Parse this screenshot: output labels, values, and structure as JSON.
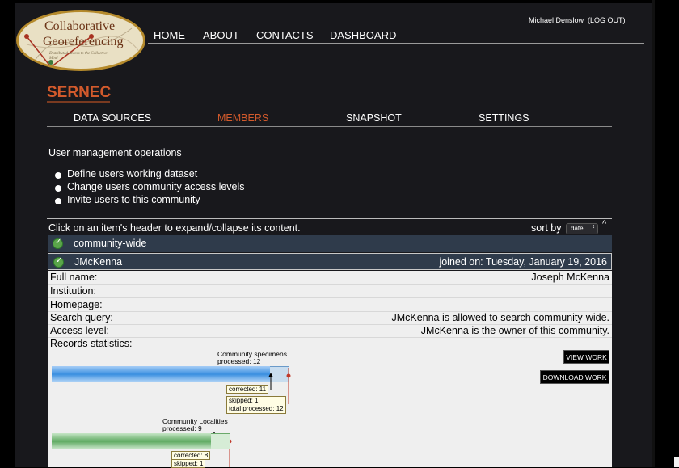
{
  "logo": {
    "line1": "Collaborative",
    "line2": "Georeferencing",
    "tagline": "Distributed Access to the Collective Mind"
  },
  "user": {
    "name": "Michael Denslow",
    "logout": "(LOG OUT)"
  },
  "nav": {
    "home": "HOME",
    "about": "ABOUT",
    "contacts": "CONTACTS",
    "dashboard": "DASHBOARD"
  },
  "community": {
    "title": "SERNEC"
  },
  "tabs": {
    "data_sources": "DATA SOURCES",
    "members": "MEMBERS",
    "snapshot": "SNAPSHOT",
    "settings": "SETTINGS",
    "active": "members"
  },
  "operations": {
    "heading": "User management operations",
    "items": [
      "Define users working dataset",
      "Change users community access levels",
      "Invite users to this community"
    ]
  },
  "list": {
    "hint": "Click on an item's header to expand/collapse its content.",
    "sort_label": "sort by",
    "sort_value": "date"
  },
  "rows": [
    {
      "label": "community-wide"
    },
    {
      "label": "JMcKenna",
      "joined": "joined on: Tuesday, January 19, 2016"
    }
  ],
  "details": {
    "full_name": {
      "key": "Full name:",
      "value": "Joseph McKenna"
    },
    "institution": {
      "key": "Institution:",
      "value": ""
    },
    "homepage": {
      "key": "Homepage:",
      "value": ""
    },
    "search_query": {
      "key": "Search query:",
      "value": "JMcKenna is allowed to search community-wide."
    },
    "access_level": {
      "key": "Access level:",
      "value": "JMcKenna is the owner of this community."
    },
    "records_statistics": {
      "key": "Records statistics:"
    }
  },
  "buttons": {
    "view_work": "VIEW WORK",
    "download_work": "DOWNLOAD WORK"
  },
  "stats": {
    "specimens": {
      "title_line1": "Community specimens",
      "title_line2": "processed: 12",
      "corrected": "corrected: 11",
      "skipped": "skipped: 1",
      "total": "total processed: 12",
      "processed_fraction": 0.92
    },
    "localities": {
      "title_line1": "Community Localities",
      "title_line2": "processed: 9",
      "corrected": "corrected: 8",
      "skipped": "skipped: 1",
      "processed_fraction": 0.89
    }
  },
  "colors": {
    "accent": "#d25a2c",
    "row_header": "#2f3b4b",
    "check": "#5aa54a",
    "bar_blue": "#3a8fe0",
    "bar_green": "#5faa62"
  }
}
